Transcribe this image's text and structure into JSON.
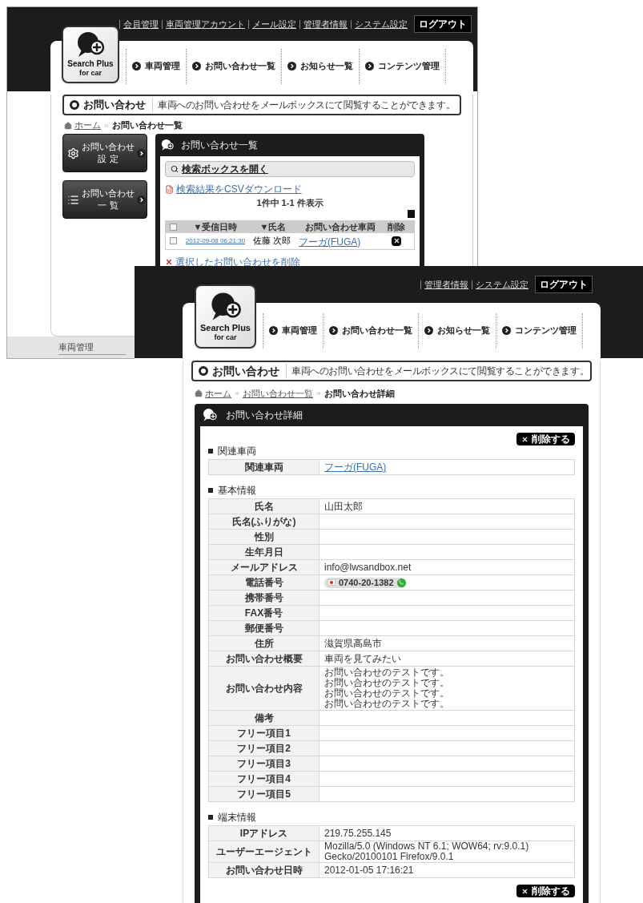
{
  "back_screen": {
    "header_links": [
      "会員管理",
      "車両管理アカウント",
      "メール設定",
      "管理者情報",
      "システム設定"
    ],
    "logout": "ログアウト",
    "logo": {
      "title": "Search Plus",
      "subtitle": "for car"
    },
    "nav": [
      "車両管理",
      "お問い合わせ一覧",
      "お知らせ一覧",
      "コンテンツ管理"
    ],
    "page_title": "お問い合わせ",
    "page_description": "車両へのお問い合わせをメールボックスにて閲覧することができます。",
    "breadcrumb": [
      {
        "label": "ホーム",
        "link": true
      },
      {
        "label": "お問い合わせ一覧",
        "link": false
      }
    ],
    "side_buttons": [
      {
        "kind": "settings",
        "lines": [
          "お問い合わせ",
          "設 定"
        ]
      },
      {
        "kind": "list",
        "lines": [
          "お問い合わせ",
          "一 覧"
        ]
      }
    ],
    "panel": {
      "title": "お問い合わせ一覧",
      "search_toggle": "検索ボックスを開く",
      "csv_link": "検索結果をCSVダウンロード",
      "count": "1件中 1-1 件表示",
      "table": {
        "select_all_checked": false,
        "columns": [
          "▼受信日時",
          "▼氏名",
          "お問い合わせ車両",
          "削除"
        ],
        "rows": [
          {
            "checked": false,
            "received": "2012-09-08 06:21:30",
            "name": "佐藤 次郎",
            "vehicle": "フーガ(FUGA)"
          }
        ]
      },
      "delete_selected": "選択したお問い合わせを削除"
    },
    "footer_menu": {
      "heading": "車両管理"
    }
  },
  "front_screen": {
    "header_links": [
      "管理者情報",
      "システム設定"
    ],
    "logout": "ログアウト",
    "logo": {
      "title": "Search Plus",
      "subtitle": "for car"
    },
    "nav": [
      "車両管理",
      "お問い合わせ一覧",
      "お知らせ一覧",
      "コンテンツ管理"
    ],
    "page_title": "お問い合わせ",
    "page_description": "車両へのお問い合わせをメールボックスにて閲覧することができます。",
    "breadcrumb": [
      {
        "label": "ホーム",
        "link": true
      },
      {
        "label": "お問い合わせ一覧",
        "link": true
      },
      {
        "label": "お問い合わせ詳細",
        "link": false
      }
    ],
    "panel_title": "お問い合わせ詳細",
    "delete_button_top": "削除する",
    "delete_button_bottom": "削除する",
    "sections": [
      {
        "heading": "関連車両",
        "rows": [
          {
            "label": "関連車両",
            "kind": "link",
            "value": "フーガ(FUGA)"
          }
        ]
      },
      {
        "heading": "基本情報",
        "rows": [
          {
            "label": "氏名",
            "kind": "text",
            "value": "山田太郎"
          },
          {
            "label": "氏名(ふりがな)",
            "kind": "empty"
          },
          {
            "label": "性別",
            "kind": "empty"
          },
          {
            "label": "生年月日",
            "kind": "empty"
          },
          {
            "label": "メールアドレス",
            "kind": "text",
            "value": "info@lwsandbox.net"
          },
          {
            "label": "電話番号",
            "kind": "phone",
            "value": "0740-20-1382"
          },
          {
            "label": "携帯番号",
            "kind": "empty"
          },
          {
            "label": "FAX番号",
            "kind": "empty"
          },
          {
            "label": "郵便番号",
            "kind": "empty"
          },
          {
            "label": "住所",
            "kind": "text",
            "value": "滋賀県高島市"
          },
          {
            "label": "お問い合わせ概要",
            "kind": "text",
            "value": "車両を見てみたい"
          },
          {
            "label": "お問い合わせ内容",
            "kind": "multiline",
            "lines": [
              "お問い合わせのテストです。",
              "お問い合わせのテストです。",
              "お問い合わせのテストです。",
              "お問い合わせのテストです。"
            ]
          },
          {
            "label": "備考",
            "kind": "empty"
          },
          {
            "label": "フリー項目1",
            "kind": "empty"
          },
          {
            "label": "フリー項目2",
            "kind": "empty"
          },
          {
            "label": "フリー項目3",
            "kind": "empty"
          },
          {
            "label": "フリー項目4",
            "kind": "empty"
          },
          {
            "label": "フリー項目5",
            "kind": "empty"
          }
        ]
      },
      {
        "heading": "端末情報",
        "rows": [
          {
            "label": "IPアドレス",
            "kind": "text",
            "value": "219.75.255.145"
          },
          {
            "label": "ユーザーエージェント",
            "kind": "text",
            "value": "Mozilla/5.0 (Windows NT 6.1; WOW64; rv:9.0.1) Gecko/20100101 Firefox/9.0.1"
          },
          {
            "label": "お問い合わせ日時",
            "kind": "text",
            "value": "2012-01-05 17:16:21"
          }
        ]
      }
    ]
  }
}
